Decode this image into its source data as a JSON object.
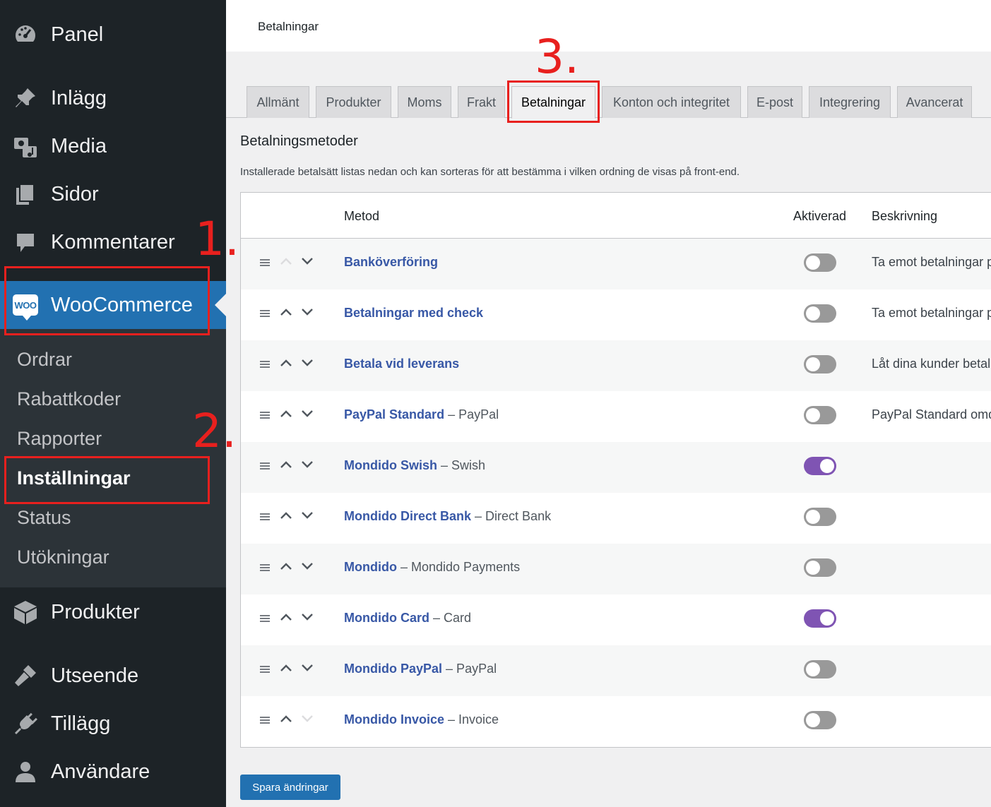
{
  "sidebar": {
    "items": [
      {
        "label": "Panel",
        "icon": "dashboard-icon"
      },
      {
        "label": "Inlägg",
        "icon": "pin-icon"
      },
      {
        "label": "Media",
        "icon": "media-icon"
      },
      {
        "label": "Sidor",
        "icon": "pages-icon"
      },
      {
        "label": "Kommentarer",
        "icon": "comment-icon"
      },
      {
        "label": "WooCommerce",
        "icon": "woo-icon"
      },
      {
        "label": "Produkter",
        "icon": "box-icon"
      },
      {
        "label": "Utseende",
        "icon": "brush-icon"
      },
      {
        "label": "Tillägg",
        "icon": "plug-icon"
      },
      {
        "label": "Användare",
        "icon": "user-icon"
      }
    ],
    "woo_badge": "WOO",
    "submenu": [
      "Ordrar",
      "Rabattkoder",
      "Rapporter",
      "Inställningar",
      "Status",
      "Utökningar"
    ],
    "current_submenu": "Inställningar"
  },
  "header": {
    "title": "Betalningar"
  },
  "tabs": [
    "Allmänt",
    "Produkter",
    "Moms",
    "Frakt",
    "Betalningar",
    "Konton och integritet",
    "E-post",
    "Integrering",
    "Avancerat"
  ],
  "active_tab": "Betalningar",
  "section": {
    "title": "Betalningsmetoder",
    "description": "Installerade betalsätt listas nedan och kan sorteras för att bestämma i vilken ordning de visas på front-end."
  },
  "table": {
    "headers": {
      "method": "Metod",
      "enabled": "Aktiverad",
      "description": "Beskrivning"
    },
    "rows": [
      {
        "name": "Banköverföring",
        "suffix": "",
        "enabled": false,
        "description": "Ta emot betalningar p"
      },
      {
        "name": "Betalningar med check",
        "suffix": "",
        "enabled": false,
        "description": "Ta emot betalningar p"
      },
      {
        "name": "Betala vid leverans",
        "suffix": "",
        "enabled": false,
        "description": "Låt dina kunder betala"
      },
      {
        "name": "PayPal Standard",
        "suffix": "– PayPal",
        "enabled": false,
        "description": "PayPal Standard omdi"
      },
      {
        "name": "Mondido Swish",
        "suffix": "– Swish",
        "enabled": true,
        "description": ""
      },
      {
        "name": "Mondido Direct Bank",
        "suffix": "– Direct Bank",
        "enabled": false,
        "description": ""
      },
      {
        "name": "Mondido",
        "suffix": "– Mondido Payments",
        "enabled": false,
        "description": ""
      },
      {
        "name": "Mondido Card",
        "suffix": "– Card",
        "enabled": true,
        "description": ""
      },
      {
        "name": "Mondido PayPal",
        "suffix": "– PayPal",
        "enabled": false,
        "description": ""
      },
      {
        "name": "Mondido Invoice",
        "suffix": "– Invoice",
        "enabled": false,
        "description": ""
      }
    ]
  },
  "save_button": "Spara ändringar",
  "annotations": [
    "1.",
    "2.",
    "3."
  ],
  "colors": {
    "accent": "#2271b1",
    "sidebar": "#1d2327",
    "toggle_on": "#7f54b3",
    "link": "#3858a6",
    "annotation": "#e8201e"
  }
}
